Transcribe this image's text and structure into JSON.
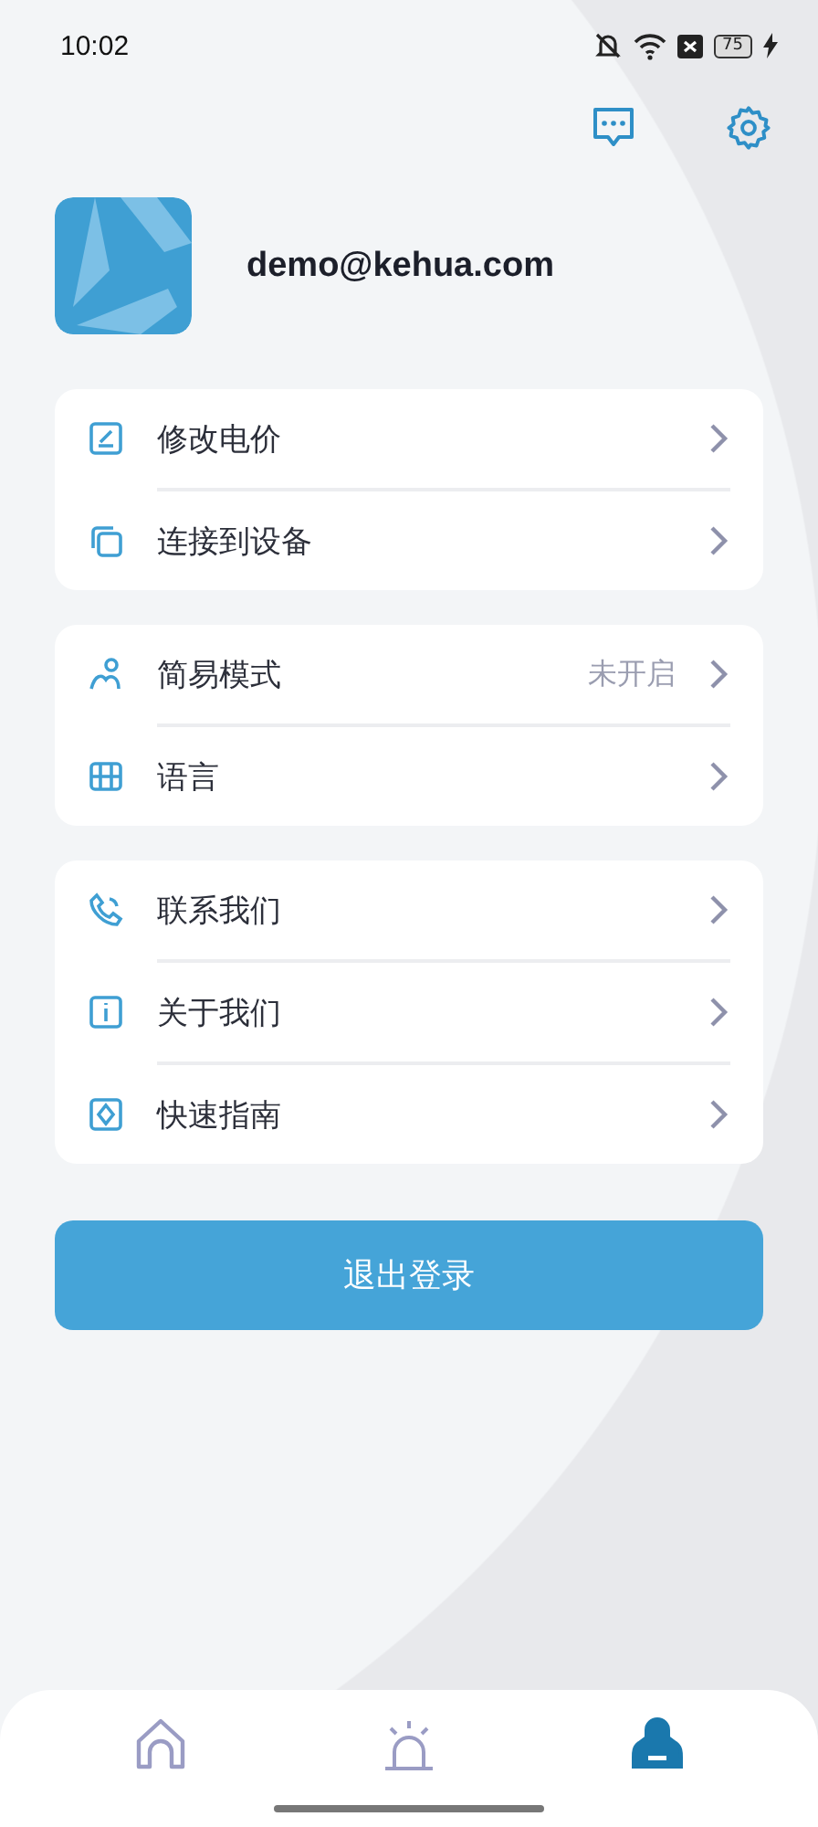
{
  "status_bar": {
    "time": "10:02",
    "battery": "75"
  },
  "profile": {
    "email": "demo@kehua.com"
  },
  "groups": [
    {
      "items": [
        {
          "kind": "edit",
          "label": "修改电价"
        },
        {
          "kind": "copy",
          "label": "连接到设备"
        }
      ]
    },
    {
      "items": [
        {
          "kind": "person",
          "label": "简易模式",
          "value": "未开启"
        },
        {
          "kind": "language",
          "label": "语言"
        }
      ]
    },
    {
      "items": [
        {
          "kind": "phone",
          "label": "联系我们"
        },
        {
          "kind": "info",
          "label": "关于我们"
        },
        {
          "kind": "guide",
          "label": "快速指南"
        }
      ]
    }
  ],
  "logout_button": "退出登录",
  "nav": [
    {
      "kind": "home",
      "selected": false
    },
    {
      "kind": "alarm",
      "selected": false
    },
    {
      "kind": "profile",
      "selected": true
    }
  ]
}
